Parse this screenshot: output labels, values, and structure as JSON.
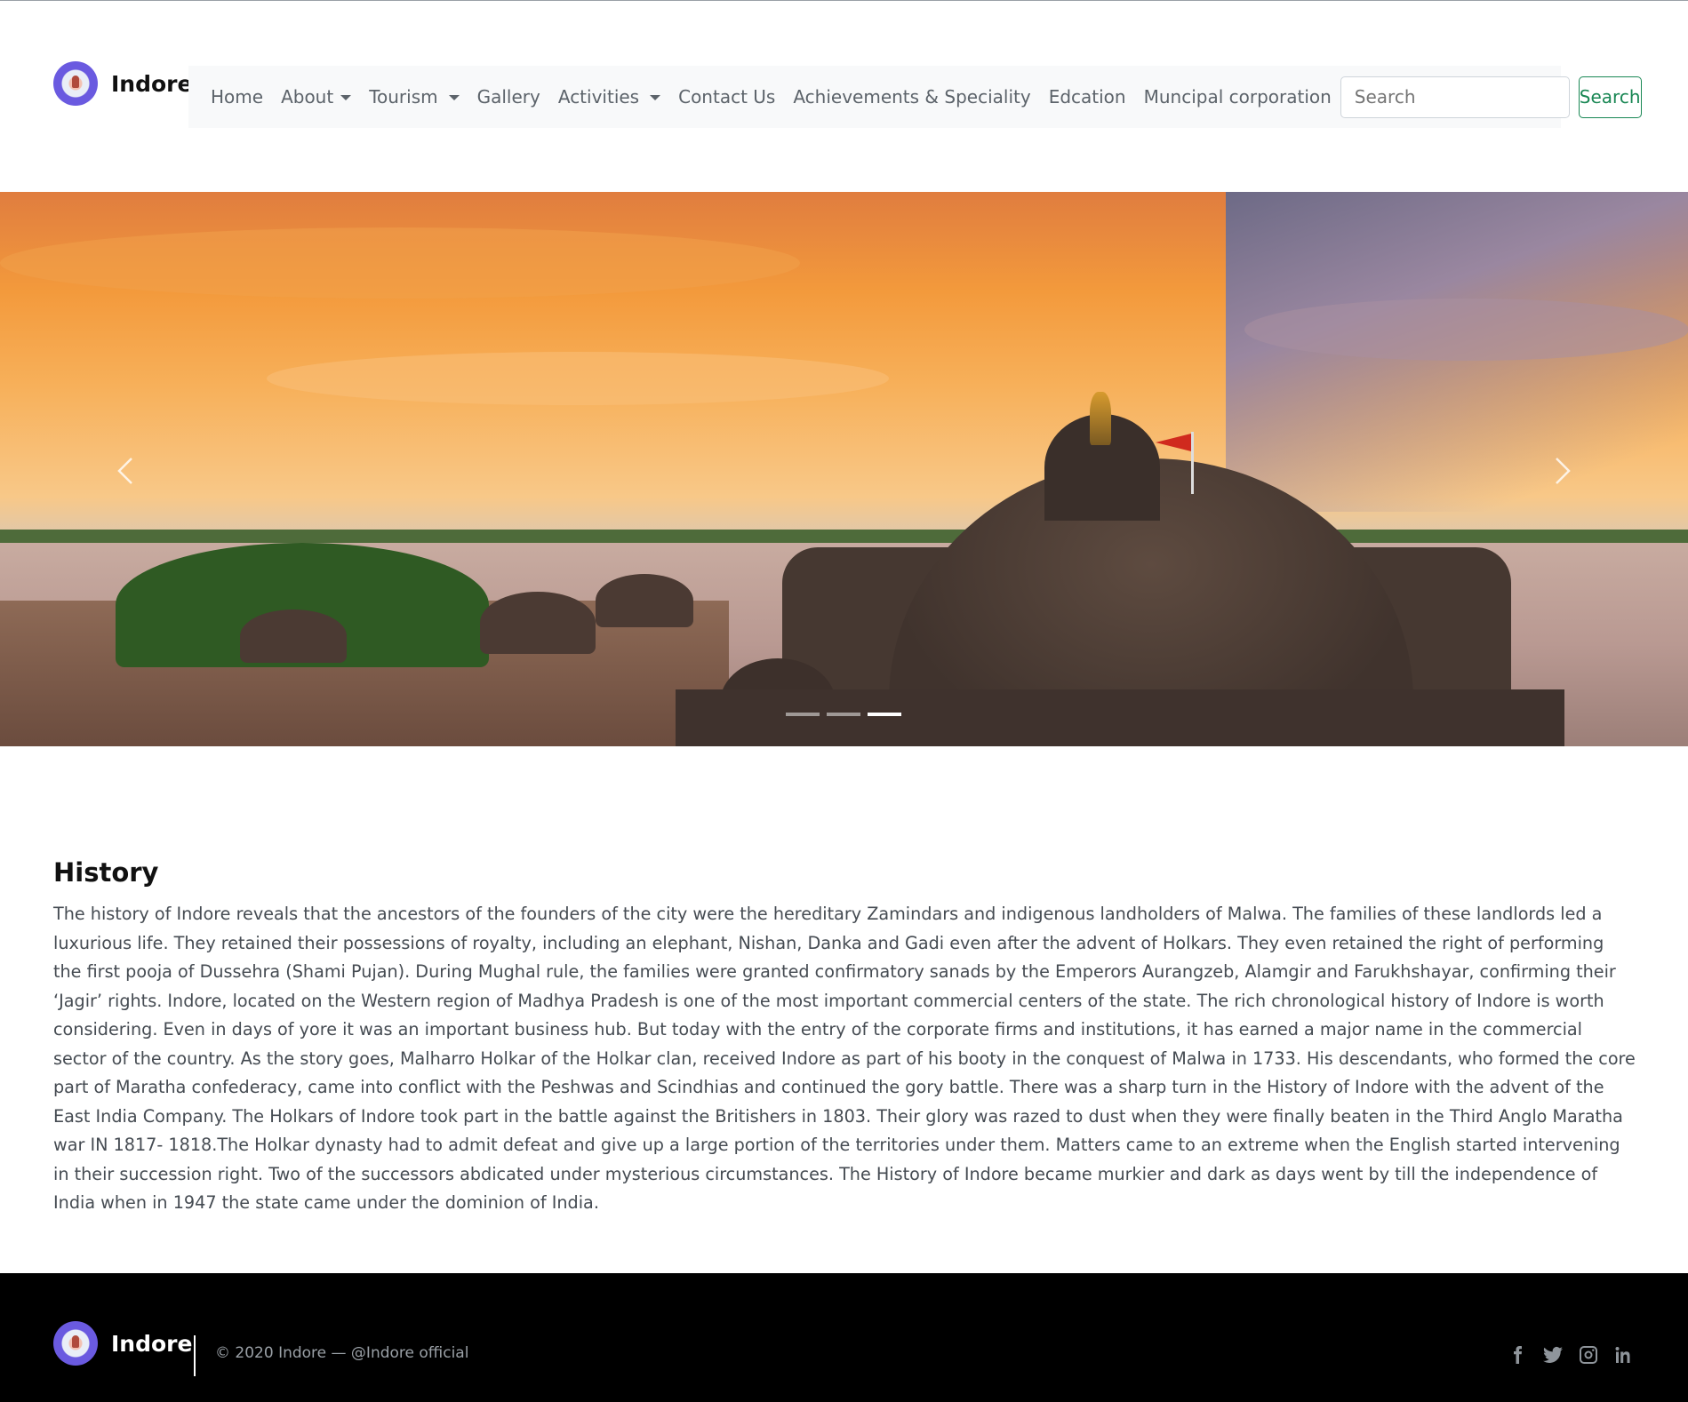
{
  "brand": {
    "name": "Indore",
    "logo_icon": "indore-logo-icon"
  },
  "nav": {
    "items": [
      {
        "label": "Home",
        "dropdown": false
      },
      {
        "label": "About",
        "dropdown": true
      },
      {
        "label": "Tourism",
        "dropdown": true
      },
      {
        "label": "Gallery",
        "dropdown": false
      },
      {
        "label": "Activities",
        "dropdown": true
      },
      {
        "label": "Contact Us",
        "dropdown": false
      },
      {
        "label": "Achievements & Speciality",
        "dropdown": false
      },
      {
        "label": "Edcation",
        "dropdown": false
      },
      {
        "label": "Muncipal corporation",
        "dropdown": false
      }
    ],
    "search_placeholder": "Search",
    "search_button": "Search"
  },
  "carousel": {
    "slide_count": 3,
    "active_index": 2,
    "prev_icon": "chevron-left-icon",
    "next_icon": "chevron-right-icon"
  },
  "history": {
    "title": "History",
    "body": "The history of Indore reveals that the ancestors of the founders of the city were the hereditary Zamindars and indigenous landholders of Malwa. The families of these landlords led a luxurious life. They retained their possessions of royalty, including an elephant, Nishan, Danka and Gadi even after the advent of Holkars. They even retained the right of performing the first pooja of Dussehra (Shami Pujan). During Mughal rule, the families were granted confirmatory sanads by the Emperors Aurangzeb, Alamgir and Farukhshayar, confirming their ‘Jagir’ rights. Indore, located on the Western region of Madhya Pradesh is one of the most important commercial centers of the state. The rich chronological history of Indore is worth considering. Even in days of yore it was an important business hub. But today with the entry of the corporate firms and institutions, it has earned a major name in the commercial sector of the country. As the story goes, Malharro Holkar of the Holkar clan, received Indore as part of his booty in the conquest of Malwa in 1733. His descendants, who formed the core part of Maratha confederacy, came into conflict with the Peshwas and Scindhias and continued the gory battle. There was a sharp turn in the History of Indore with the advent of the East India Company. The Holkars of Indore took part in the battle against the Britishers in 1803. Their glory was razed to dust when they were finally beaten in the Third Anglo Maratha war IN 1817- 1818.The Holkar dynasty had to admit defeat and give up a large portion of the territories under them. Matters came to an extreme when the English started intervening in their succession right. Two of the successors abdicated under mysterious circumstances. The History of Indore became murkier and dark as days went by till the independence of India when in 1947 the state came under the dominion of India."
  },
  "footer": {
    "brand_name": "Indore",
    "copyright": "© 2020 Indore —  @Indore official",
    "socials": [
      "facebook-icon",
      "twitter-icon",
      "instagram-icon",
      "linkedin-icon"
    ]
  },
  "colors": {
    "navbar_bg": "#f8f9fa",
    "search_accent": "#198754",
    "footer_bg": "#000000"
  }
}
